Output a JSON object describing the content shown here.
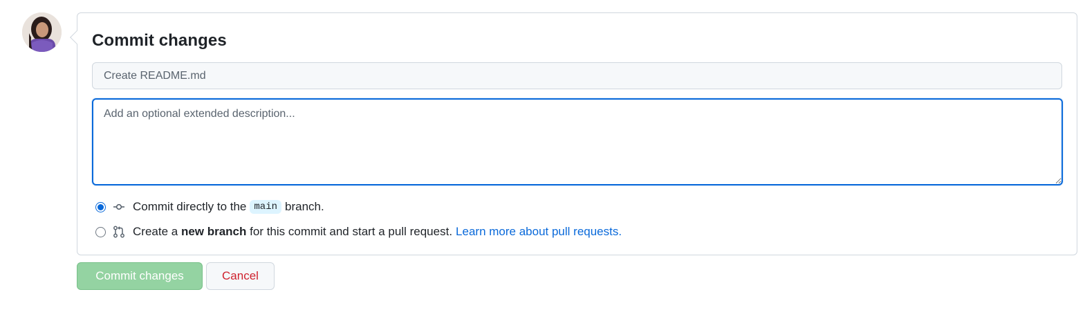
{
  "avatar": {
    "icon": "user-avatar"
  },
  "commit_form": {
    "title": "Commit changes",
    "summary_placeholder": "Create README.md",
    "summary_value": "",
    "description_placeholder": "Add an optional extended description...",
    "description_value": "",
    "options": [
      {
        "icon": "git-commit-icon",
        "checked": true,
        "prefix": "Commit directly to the",
        "branch": "main",
        "suffix": "branch."
      },
      {
        "icon": "git-pull-request-icon",
        "checked": false,
        "prefix": "Create a",
        "bold": "new branch",
        "suffix": "for this commit and start a pull request.",
        "link_text": "Learn more about pull requests."
      }
    ]
  },
  "actions": {
    "commit_label": "Commit changes",
    "cancel_label": "Cancel"
  },
  "colors": {
    "accent": "#0969da",
    "commit_button_disabled": "#94d3a2",
    "cancel_text": "#cf222e",
    "border": "#d0d7de"
  }
}
